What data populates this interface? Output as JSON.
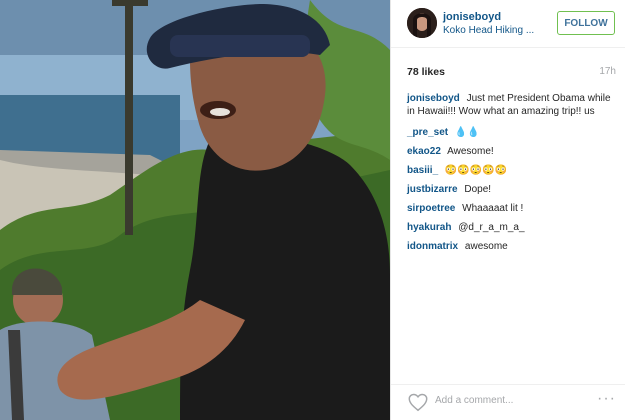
{
  "post": {
    "username": "joniseboyd",
    "location": "Koko Head Hiking ...",
    "follow_label": "FOLLOW",
    "likes": "78 likes",
    "time": "17h",
    "add_comment_placeholder": "Add a comment...",
    "more_icon": "···"
  },
  "comments": [
    {
      "user": "joniseboyd",
      "text": "Just met President Obama while in Hawaii!!! Wow what an amazing trip!! us"
    },
    {
      "user": "_pre_set",
      "text": "💧💧"
    },
    {
      "user": "ekao22",
      "text": "Awesome!"
    },
    {
      "user": "basiii_",
      "text": "😳😳😳😳😳"
    },
    {
      "user": "justbizarre",
      "text": "Dope!"
    },
    {
      "user": "sirpoetree",
      "text": "Whaaaaat lit !"
    },
    {
      "user": "hyakurah",
      "text": "@d_r_a_m_a_"
    },
    {
      "user": "idonmatrix",
      "text": "awesome"
    }
  ],
  "colors": {
    "link": "#125688",
    "follow_border": "#70c050",
    "follow_text": "#3f729b",
    "muted": "#a5a7aa"
  },
  "icons": {
    "heart": "heart-icon",
    "avatar": "avatar"
  }
}
